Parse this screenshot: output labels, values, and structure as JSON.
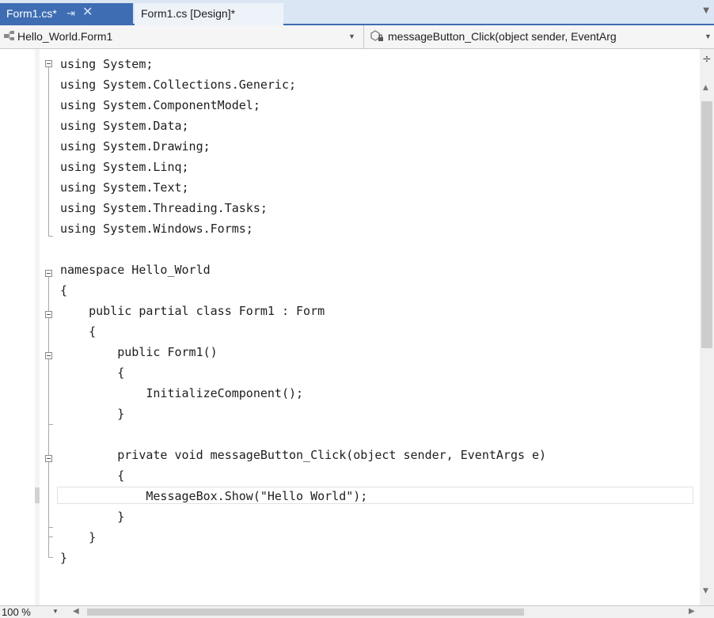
{
  "tabs": [
    {
      "label": "Form1.cs*",
      "active": true,
      "pin_glyph": "⇥",
      "close_glyph": "✕"
    },
    {
      "label": "Form1.cs [Design]*",
      "active": false
    }
  ],
  "navbar": {
    "class_selector": "Hello_World.Form1",
    "member_selector": "messageButton_Click(object sender, EventArg"
  },
  "code_lines": [
    "using System;",
    "using System.Collections.Generic;",
    "using System.ComponentModel;",
    "using System.Data;",
    "using System.Drawing;",
    "using System.Linq;",
    "using System.Text;",
    "using System.Threading.Tasks;",
    "using System.Windows.Forms;",
    "",
    "namespace Hello_World",
    "{",
    "    public partial class Form1 : Form",
    "    {",
    "        public Form1()",
    "        {",
    "            InitializeComponent();",
    "        }",
    "",
    "        private void messageButton_Click(object sender, EventArgs e)",
    "        {",
    "            MessageBox.Show(\"Hello World\");",
    "        }",
    "    }",
    "}"
  ],
  "statusbar": {
    "zoom": "100 %"
  },
  "colors": {
    "active_tab": "#3e6db3",
    "chrome_background": "#d8e3f0",
    "editor_background": "#ffffff"
  },
  "icons": {
    "class_icon": "class-icon",
    "method_icon": "private-method-icon"
  }
}
